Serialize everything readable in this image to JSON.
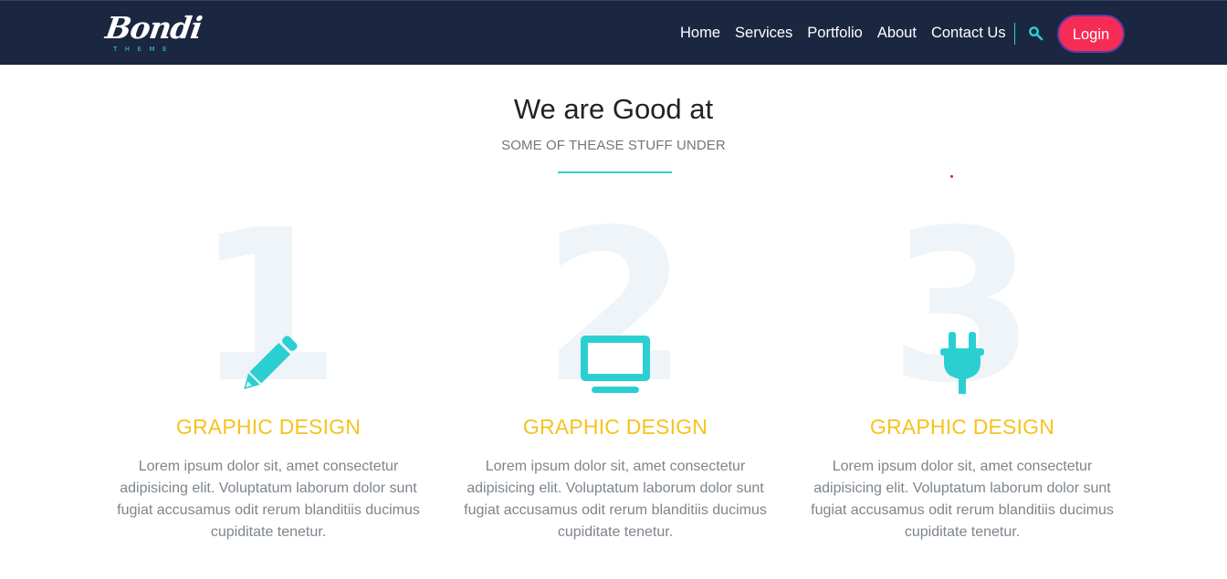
{
  "brand": {
    "logo_text": "Bondi",
    "logo_subtext": "THEME"
  },
  "nav": {
    "items": [
      {
        "label": "Home"
      },
      {
        "label": "Services"
      },
      {
        "label": "Portfolio"
      },
      {
        "label": "About"
      },
      {
        "label": "Contact Us"
      }
    ],
    "search_icon": "search-icon",
    "login_label": "Login"
  },
  "section": {
    "title": "We are Good at",
    "subtitle": "SOME OF THEASE STUFF UNDER"
  },
  "cards": [
    {
      "number": "1",
      "icon": "pencil-icon",
      "title": "GRAPHIC DESIGN",
      "text": "Lorem ipsum dolor sit, amet consectetur adipisicing elit. Voluptatum laborum dolor sunt fugiat accusamus odit rerum blanditiis ducimus cupiditate tenetur."
    },
    {
      "number": "2",
      "icon": "monitor-icon",
      "title": "GRAPHIC DESIGN",
      "text": "Lorem ipsum dolor sit, amet consectetur adipisicing elit. Voluptatum laborum dolor sunt fugiat accusamus odit rerum blanditiis ducimus cupiditate tenetur."
    },
    {
      "number": "3",
      "icon": "plug-icon",
      "title": "GRAPHIC DESIGN",
      "text": "Lorem ipsum dolor sit, amet consectetur adipisicing elit. Voluptatum laborum dolor sunt fugiat accusamus odit rerum blanditiis ducimus cupiditate tenetur."
    }
  ],
  "colors": {
    "navbar_bg": "#1b2740",
    "accent_teal": "#2ccfd1",
    "login_bg": "#f72c55",
    "card_title": "#f6c31c",
    "big_number": "#eef4f8"
  }
}
